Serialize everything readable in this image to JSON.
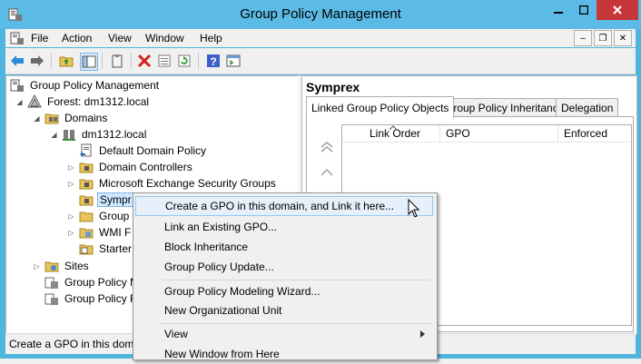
{
  "window": {
    "title": "Group Policy Management",
    "controls": [
      "minimize-icon",
      "maximize-icon",
      "close-icon"
    ]
  },
  "menubar": {
    "items": [
      "File",
      "Action",
      "View",
      "Window",
      "Help"
    ]
  },
  "toolbar": {
    "buttons": [
      "back-icon",
      "forward-icon",
      "up-folder-icon",
      "show-hide-tree-icon",
      "clipboard-icon",
      "delete-icon",
      "properties-icon",
      "refresh-icon",
      "help-icon",
      "console-icon"
    ]
  },
  "tree": {
    "items": [
      {
        "label": "Group Policy Management",
        "icon": "gpm-icon",
        "level": 0
      },
      {
        "label": "Forest: dm1312.local",
        "icon": "forest-icon",
        "level": 1
      },
      {
        "label": "Domains",
        "icon": "domains-icon",
        "level": 2
      },
      {
        "label": "dm1312.local",
        "icon": "domain-icon",
        "level": 3
      },
      {
        "label": "Default Domain Policy",
        "icon": "gpo-link-icon",
        "level": 4
      },
      {
        "label": "Domain Controllers",
        "icon": "ou-folder-icon",
        "level": 4
      },
      {
        "label": "Microsoft Exchange Security Groups",
        "icon": "ou-folder-icon",
        "level": 4
      },
      {
        "label": "Sympr",
        "icon": "ou-folder-icon",
        "level": 4
      },
      {
        "label": "Group",
        "icon": "folder-icon",
        "level": 4
      },
      {
        "label": "WMI F",
        "icon": "wmi-folder-icon",
        "level": 4
      },
      {
        "label": "Starter",
        "icon": "starter-folder-icon",
        "level": 4
      },
      {
        "label": "Sites",
        "icon": "sites-icon",
        "level": 1
      },
      {
        "label": "Group Policy M",
        "icon": "modeling-icon",
        "level": 1
      },
      {
        "label": "Group Policy R",
        "icon": "results-icon",
        "level": 1
      }
    ]
  },
  "details": {
    "title": "Symprex",
    "tabs": [
      "Linked Group Policy Objects",
      "Group Policy Inheritance",
      "Delegation"
    ],
    "columns": [
      "Link Order",
      "GPO",
      "Enforced"
    ]
  },
  "context_menu": {
    "items": [
      "Create a GPO in this domain, and Link it here...",
      "Link an Existing GPO...",
      "Block Inheritance",
      "Group Policy Update...",
      "Group Policy Modeling Wizard...",
      "New Organizational Unit",
      "View",
      "New Window from Here"
    ]
  },
  "status": {
    "text": "Create a GPO in this domain"
  },
  "colors": {
    "titlebar": "#5bbbe6",
    "close_button": "#c7373a",
    "selection": "#cde8ff",
    "menu_highlight": "#e5f0fa"
  }
}
